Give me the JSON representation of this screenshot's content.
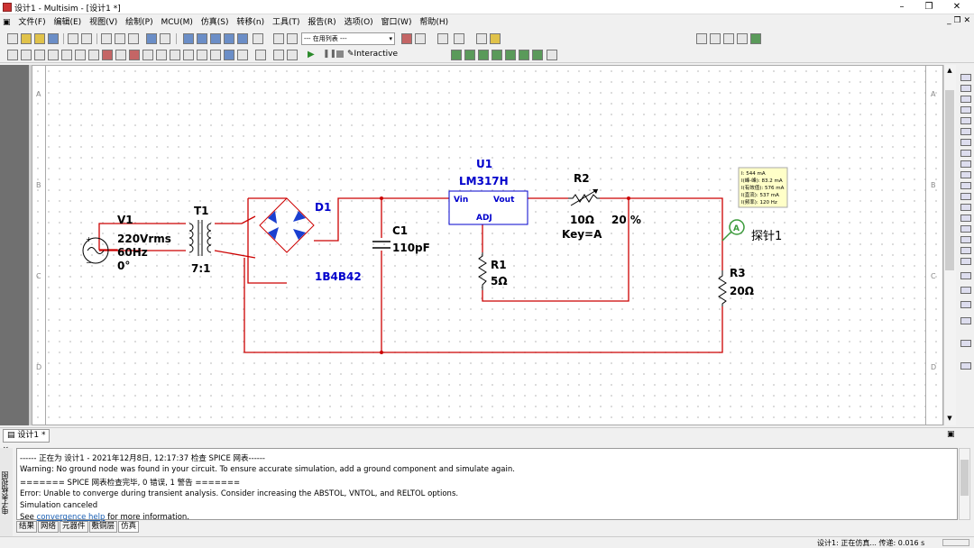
{
  "window": {
    "title": "设计1 - Multisim - [设计1 *]"
  },
  "menu": {
    "items": [
      "文件(F)",
      "编辑(E)",
      "视图(V)",
      "绘制(P)",
      "MCU(M)",
      "仿真(S)",
      "转移(n)",
      "工具(T)",
      "报告(R)",
      "选项(O)",
      "窗口(W)",
      "帮助(H)"
    ]
  },
  "toolbar": {
    "in_use_list": "--- 在用列表 ---",
    "interactive_label": "Interactive"
  },
  "schematic": {
    "border_rows": [
      "A",
      "B",
      "C",
      "D"
    ],
    "V1": {
      "ref": "V1",
      "spec1": "220Vrms",
      "spec2": "60Hz",
      "spec3": "0°"
    },
    "T1": {
      "ref": "T1",
      "ratio": "7:1"
    },
    "D1": {
      "ref": "D1",
      "model": "1B4B42"
    },
    "C1": {
      "ref": "C1",
      "value": "110pF"
    },
    "U1": {
      "ref": "U1",
      "model": "LM317H",
      "pin_vin": "Vin",
      "pin_vout": "Vout",
      "pin_adj": "ADJ"
    },
    "R1": {
      "ref": "R1",
      "value": "5Ω"
    },
    "R2": {
      "ref": "R2",
      "value": "10Ω",
      "percent": "20 %",
      "key": "Key=A"
    },
    "R3": {
      "ref": "R3",
      "value": "20Ω"
    },
    "probe": {
      "label": "探针1",
      "symbol": "A",
      "readings": [
        "I: 544 mA",
        "I(峰-峰): 83.2 mA",
        "I(有效值): 576 mA",
        "I(直流): 537 mA",
        "I(频率): 120 Hz"
      ]
    }
  },
  "doc_tab": {
    "label": "设计1 *"
  },
  "output": {
    "side_caption": "电子表格视图",
    "lines": [
      "------ 正在为 设计1 - 2021年12月8日, 12:17:37 检查 SPICE 网表------",
      "Warning: No ground node was found in your circuit. To ensure accurate simulation, add a ground component and simulate again.",
      "======= SPICE 网表检查完毕, 0 错误, 1 警告 =======",
      "Error: Unable to converge during transient analysis. Consider increasing the ABSTOL, VNTOL, and RELTOL options.",
      "Simulation canceled"
    ],
    "see_prefix": "See ",
    "see_link": "convergence help",
    "see_suffix": " for more information.",
    "tabs": [
      "结果",
      "网络",
      "元器件",
      "敷铜层",
      "仿真"
    ]
  },
  "status": {
    "text": "设计1: 正在仿真... 传递: 0.016 s"
  },
  "colors": {
    "wire": "#cc0000",
    "component": "#0000cc",
    "label": "#000000",
    "accent_blue": "#1a5fb4"
  }
}
